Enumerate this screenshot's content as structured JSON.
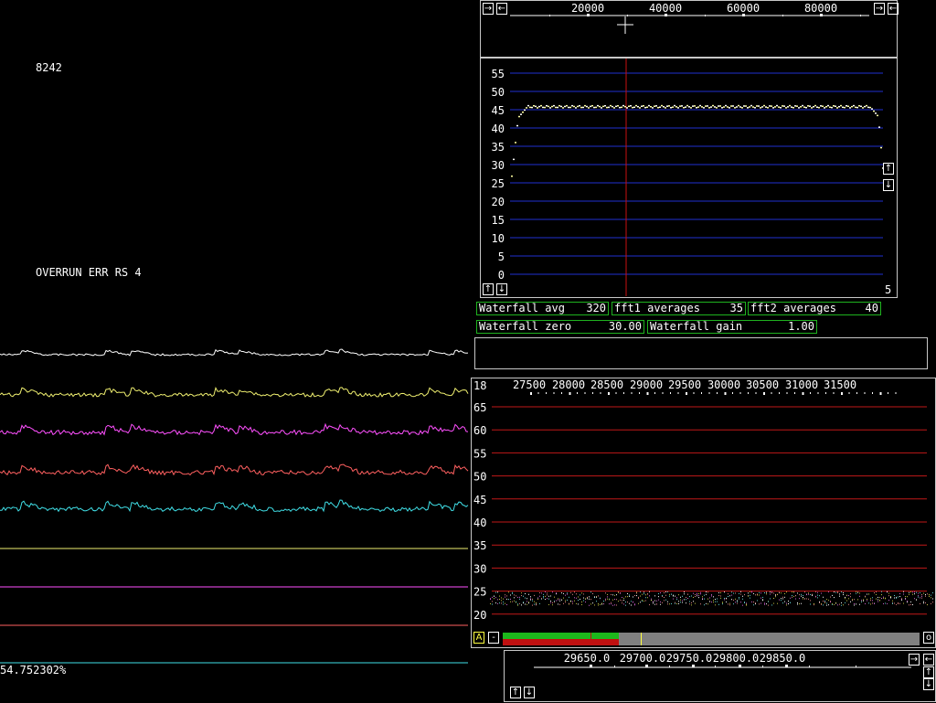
{
  "status": {
    "counter": "8242",
    "overrun": "OVERRUN ERR RS 4",
    "percent": "54.752302%"
  },
  "top_scale": {
    "ticks": [
      "20000",
      "40000",
      "60000",
      "80000"
    ]
  },
  "spectrum_panel": {
    "y_ticks": [
      "55",
      "50",
      "45",
      "40",
      "35",
      "30",
      "25",
      "20",
      "15",
      "10",
      "5",
      "0"
    ],
    "corner_value": "5"
  },
  "params": [
    {
      "label": "Waterfall avg",
      "value": "320"
    },
    {
      "label": "fft1 averages",
      "value": "35"
    },
    {
      "label": "fft2 averages",
      "value": "40"
    },
    {
      "label": "Waterfall zero",
      "value": "30.00"
    },
    {
      "label": "Waterfall gain",
      "value": "1.00"
    }
  ],
  "main_spectrum": {
    "corner_value": "18",
    "x_ticks": [
      "27500",
      "28000",
      "28500",
      "29000",
      "29500",
      "30000",
      "30500",
      "31000",
      "31500"
    ],
    "y_ticks": [
      "65",
      "60",
      "55",
      "50",
      "45",
      "40",
      "35",
      "30",
      "25",
      "20"
    ],
    "a_button": "A",
    "minus_button": "-",
    "o_button": "o",
    "level_fraction": 0.3
  },
  "bottom_scale": {
    "x_ticks": [
      "29650.0",
      "29700.0",
      "29750.0",
      "29800.0",
      "29850.0"
    ]
  },
  "buttons": {
    "right": "→",
    "left": "←",
    "up": "↑",
    "down": "↓"
  },
  "colors": {
    "grid_blue": "#1f2fd0",
    "grid_red": "#c01818",
    "cursor_red": "#c81010",
    "panel_border": "#c8c8c8",
    "param_border": "#1fb31f",
    "bar_green": "#1cb81c",
    "bar_red": "#c01010",
    "bar_gray": "#808080",
    "trace_white": "#ffffff",
    "trace_yellow": "#f0f070",
    "trace_magenta": "#ff50ff",
    "trace_red": "#ff6060",
    "trace_cyan": "#40e0e8"
  }
}
